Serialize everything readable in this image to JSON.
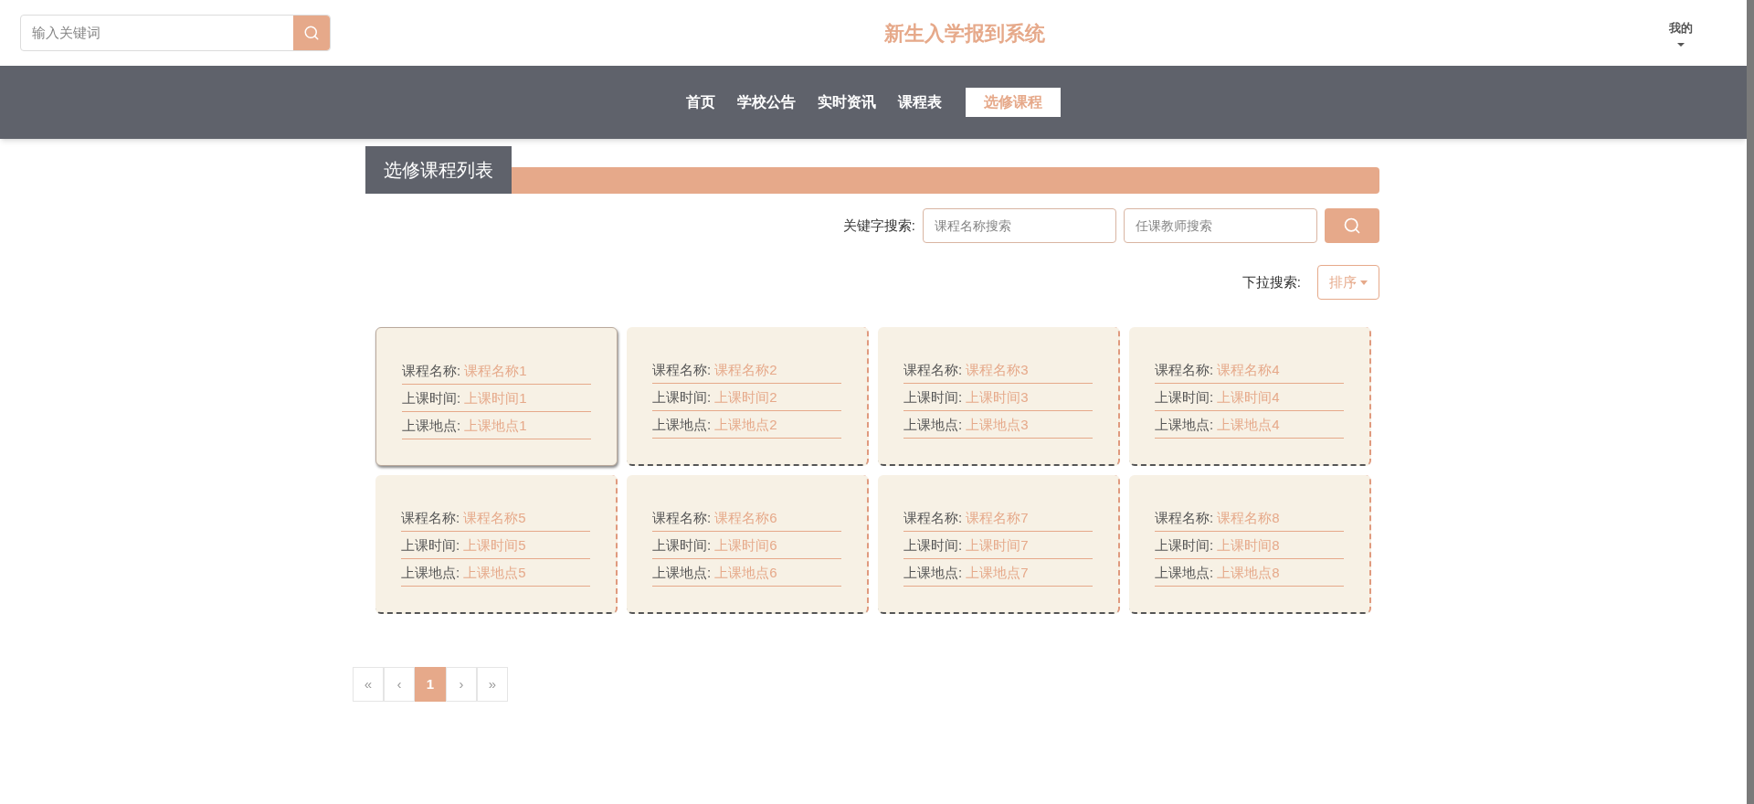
{
  "header": {
    "search": {
      "placeholder": "输入关键词"
    },
    "title": "新生入学报到系统",
    "user_menu": "我的"
  },
  "nav": [
    {
      "label": "首页",
      "selected": false
    },
    {
      "label": "学校公告",
      "selected": false
    },
    {
      "label": "实时资讯",
      "selected": false
    },
    {
      "label": "课程表",
      "selected": false
    },
    {
      "label": "选修课程",
      "selected": true
    }
  ],
  "section_title": "选修课程列表",
  "filters": {
    "keyword_label": "关键字搜索:",
    "name_placeholder": "课程名称搜索",
    "teacher_placeholder": "任课教师搜索",
    "dropdown_label": "下拉搜索:",
    "sort_button": "排序"
  },
  "courses": [
    {
      "highlighted": true,
      "fields": [
        {
          "label": "课程名称:",
          "value": "课程名称1"
        },
        {
          "label": "上课时间:",
          "value": "上课时间1"
        },
        {
          "label": "上课地点:",
          "value": "上课地点1"
        }
      ]
    },
    {
      "highlighted": false,
      "fields": [
        {
          "label": "课程名称:",
          "value": "课程名称2"
        },
        {
          "label": "上课时间:",
          "value": "上课时间2"
        },
        {
          "label": "上课地点:",
          "value": "上课地点2"
        }
      ]
    },
    {
      "highlighted": false,
      "fields": [
        {
          "label": "课程名称:",
          "value": "课程名称3"
        },
        {
          "label": "上课时间:",
          "value": "上课时间3"
        },
        {
          "label": "上课地点:",
          "value": "上课地点3"
        }
      ]
    },
    {
      "highlighted": false,
      "fields": [
        {
          "label": "课程名称:",
          "value": "课程名称4"
        },
        {
          "label": "上课时间:",
          "value": "上课时间4"
        },
        {
          "label": "上课地点:",
          "value": "上课地点4"
        }
      ]
    },
    {
      "highlighted": false,
      "fields": [
        {
          "label": "课程名称:",
          "value": "课程名称5"
        },
        {
          "label": "上课时间:",
          "value": "上课时间5"
        },
        {
          "label": "上课地点:",
          "value": "上课地点5"
        }
      ]
    },
    {
      "highlighted": false,
      "fields": [
        {
          "label": "课程名称:",
          "value": "课程名称6"
        },
        {
          "label": "上课时间:",
          "value": "上课时间6"
        },
        {
          "label": "上课地点:",
          "value": "上课地点6"
        }
      ]
    },
    {
      "highlighted": false,
      "fields": [
        {
          "label": "课程名称:",
          "value": "课程名称7"
        },
        {
          "label": "上课时间:",
          "value": "上课时间7"
        },
        {
          "label": "上课地点:",
          "value": "上课地点7"
        }
      ]
    },
    {
      "highlighted": false,
      "fields": [
        {
          "label": "课程名称:",
          "value": "课程名称8"
        },
        {
          "label": "上课时间:",
          "value": "上课时间8"
        },
        {
          "label": "上课地点:",
          "value": "上课地点8"
        }
      ]
    }
  ],
  "pagination": [
    {
      "label": "«",
      "selected": false
    },
    {
      "label": "‹",
      "selected": false
    },
    {
      "label": "1",
      "selected": true
    },
    {
      "label": "›",
      "selected": false
    },
    {
      "label": "»",
      "selected": false
    }
  ]
}
